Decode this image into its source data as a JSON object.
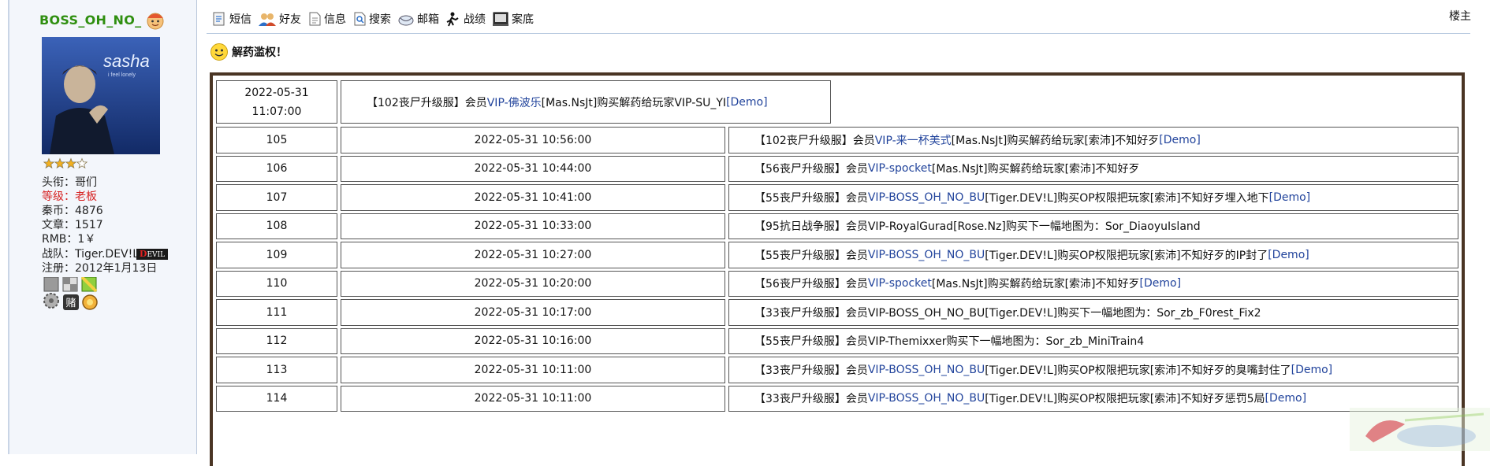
{
  "profile": {
    "username": "BOSS_OH_NO_",
    "avatar_text": "sasha",
    "avatar_subtext": "i feel lonely",
    "lines": [
      {
        "label": "头衔：",
        "value": "哥们"
      },
      {
        "label": "等级：",
        "value": "老板"
      },
      {
        "label": "秦币：",
        "value": "4876"
      },
      {
        "label": "文章：",
        "value": "1517"
      },
      {
        "label": "RMB：",
        "value": "1￥"
      },
      {
        "label": "战队：",
        "value": "Tiger.DEV!L"
      },
      {
        "label": "注册：",
        "value": "2012年1月13日"
      }
    ],
    "team_badge": "EVIL",
    "team_badge_initial": "D",
    "stars": 4,
    "stars_filled": 3
  },
  "toolbar": {
    "items": [
      "短信",
      "好友",
      "信息",
      "搜索",
      "邮箱",
      "战绩",
      "案底"
    ]
  },
  "floor_label": "楼主",
  "post_title": "解药滥权！",
  "log": {
    "first_row": {
      "time": "2022-05-31 11:07:00",
      "parts": [
        {
          "t": "【102丧尸升级服】会员",
          "link": false
        },
        {
          "t": "VIP-佛波乐",
          "link": true
        },
        {
          "t": "[Mas.NsJt]购买解药给玩家VIP-SU_YI",
          "link": false
        },
        {
          "t": "[Demo]",
          "link": true
        }
      ]
    },
    "rows": [
      {
        "id": "105",
        "time": "2022-05-31 10:56:00",
        "parts": [
          {
            "t": "【102丧尸升级服】会员",
            "link": false
          },
          {
            "t": "VIP-来一杯美式",
            "link": true
          },
          {
            "t": "[Mas.NsJt]购买解药给玩家[索沛]不知好歹",
            "link": false
          },
          {
            "t": "[Demo]",
            "link": true
          }
        ]
      },
      {
        "id": "106",
        "time": "2022-05-31 10:44:00",
        "parts": [
          {
            "t": "【56丧尸升级服】会员",
            "link": false
          },
          {
            "t": "VIP-spocket",
            "link": true
          },
          {
            "t": "[Mas.NsJt]购买解药给玩家[索沛]不知好歹",
            "link": false
          }
        ]
      },
      {
        "id": "107",
        "time": "2022-05-31 10:41:00",
        "parts": [
          {
            "t": "【55丧尸升级服】会员",
            "link": false
          },
          {
            "t": "VIP-BOSS_OH_NO_BU",
            "link": true
          },
          {
            "t": "[Tiger.DEV!L]购买OP权限把玩家[索沛]不知好歹埋入地下",
            "link": false
          },
          {
            "t": "[Demo]",
            "link": true
          }
        ]
      },
      {
        "id": "108",
        "time": "2022-05-31 10:33:00",
        "parts": [
          {
            "t": "【95抗日战争服】会员VIP-RoyalGurad[Rose.Nz]购买下一幅地图为：Sor_DiaoyuIsland",
            "link": false
          }
        ]
      },
      {
        "id": "109",
        "time": "2022-05-31 10:27:00",
        "parts": [
          {
            "t": "【55丧尸升级服】会员",
            "link": false
          },
          {
            "t": "VIP-BOSS_OH_NO_BU",
            "link": true
          },
          {
            "t": "[Tiger.DEV!L]购买OP权限把玩家[索沛]不知好歹的IP封了",
            "link": false
          },
          {
            "t": "[Demo]",
            "link": true
          }
        ]
      },
      {
        "id": "110",
        "time": "2022-05-31 10:20:00",
        "parts": [
          {
            "t": "【56丧尸升级服】会员",
            "link": false
          },
          {
            "t": "VIP-spocket",
            "link": true
          },
          {
            "t": "[Mas.NsJt]购买解药给玩家[索沛]不知好歹",
            "link": false
          },
          {
            "t": "[Demo]",
            "link": true
          }
        ]
      },
      {
        "id": "111",
        "time": "2022-05-31 10:17:00",
        "parts": [
          {
            "t": "【33丧尸升级服】会员VIP-BOSS_OH_NO_BU[Tiger.DEV!L]购买下一幅地图为：Sor_zb_F0rest_Fix2",
            "link": false
          }
        ]
      },
      {
        "id": "112",
        "time": "2022-05-31 10:16:00",
        "parts": [
          {
            "t": "【55丧尸升级服】会员VIP-Themixxer购买下一幅地图为：Sor_zb_MiniTrain4",
            "link": false
          }
        ]
      },
      {
        "id": "113",
        "time": "2022-05-31 10:11:00",
        "parts": [
          {
            "t": "【33丧尸升级服】会员",
            "link": false
          },
          {
            "t": "VIP-BOSS_OH_NO_BU",
            "link": true
          },
          {
            "t": "[Tiger.DEV!L]购买OP权限把玩家[索沛]不知好歹的臭嘴封住了",
            "link": false
          },
          {
            "t": "[Demo]",
            "link": true
          }
        ]
      },
      {
        "id": "114",
        "time": "2022-05-31 10:11:00",
        "parts": [
          {
            "t": "【33丧尸升级服】会员",
            "link": false
          },
          {
            "t": "VIP-BOSS_OH_NO_BU",
            "link": true
          },
          {
            "t": "[Tiger.DEV!L]购买OP权限把玩家[索沛]不知好歹惩罚5局",
            "link": false
          },
          {
            "t": "[Demo]",
            "link": true
          }
        ]
      }
    ]
  },
  "colors": {
    "username": "#2f8f10",
    "level": "#d62222",
    "link": "#22449c",
    "frame": "#4a3524",
    "divider": "#b7c9df",
    "sidebar_bg": "#f3f6fb"
  },
  "icons": [
    "sms-icon",
    "friends-icon",
    "info-icon",
    "search-icon",
    "mail-icon",
    "record-icon",
    "case-icon"
  ]
}
